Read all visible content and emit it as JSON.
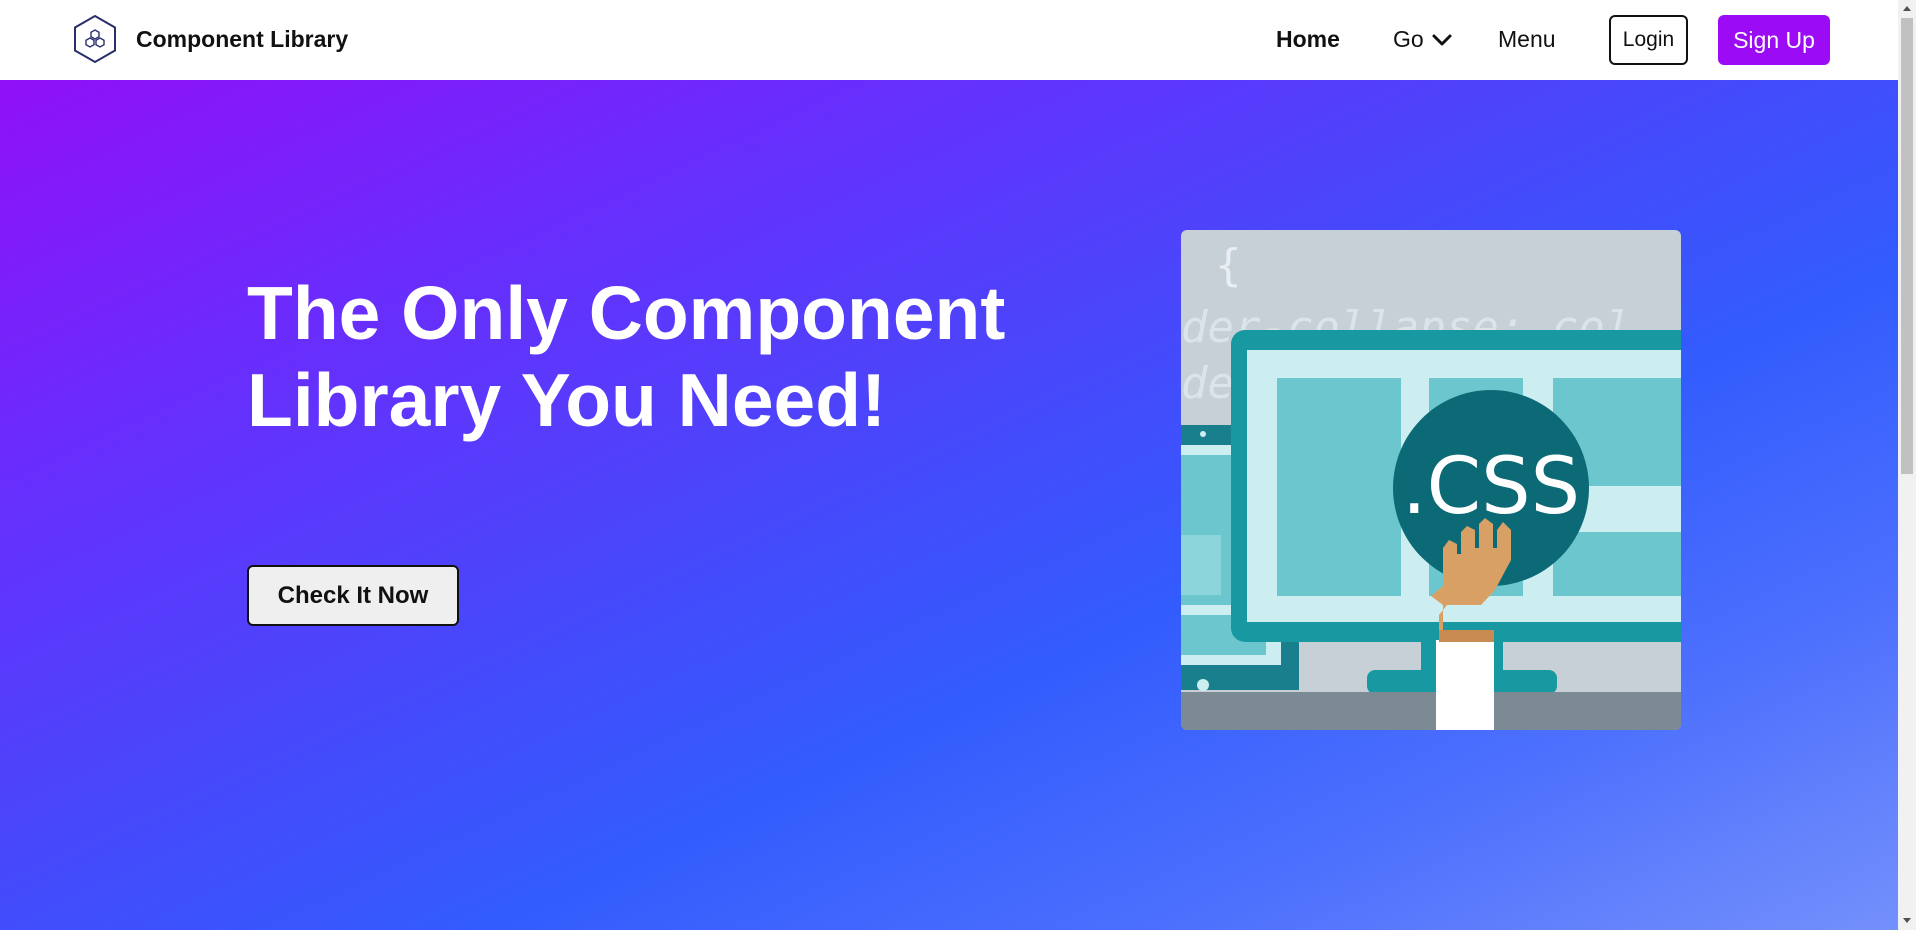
{
  "nav": {
    "brand_name": "Component Library",
    "logo_icon": "hexagon-cubes-logo",
    "links": {
      "home": "Home",
      "go": "Go",
      "menu": "Menu"
    },
    "login_label": "Login",
    "signup_label": "Sign Up"
  },
  "hero": {
    "title": "The Only Component Library You Need!",
    "cta_label": "Check It Now",
    "image": {
      "icon": "css-illustration",
      "badge_text": ".CSS",
      "code_lines": [
        "{",
        "der-collapse: col",
        "de"
      ]
    }
  },
  "colors": {
    "accent": "#9b0cf5",
    "gradient_start": "#9010f7",
    "gradient_mid": "#325cfd",
    "gradient_end": "#7490fc"
  }
}
